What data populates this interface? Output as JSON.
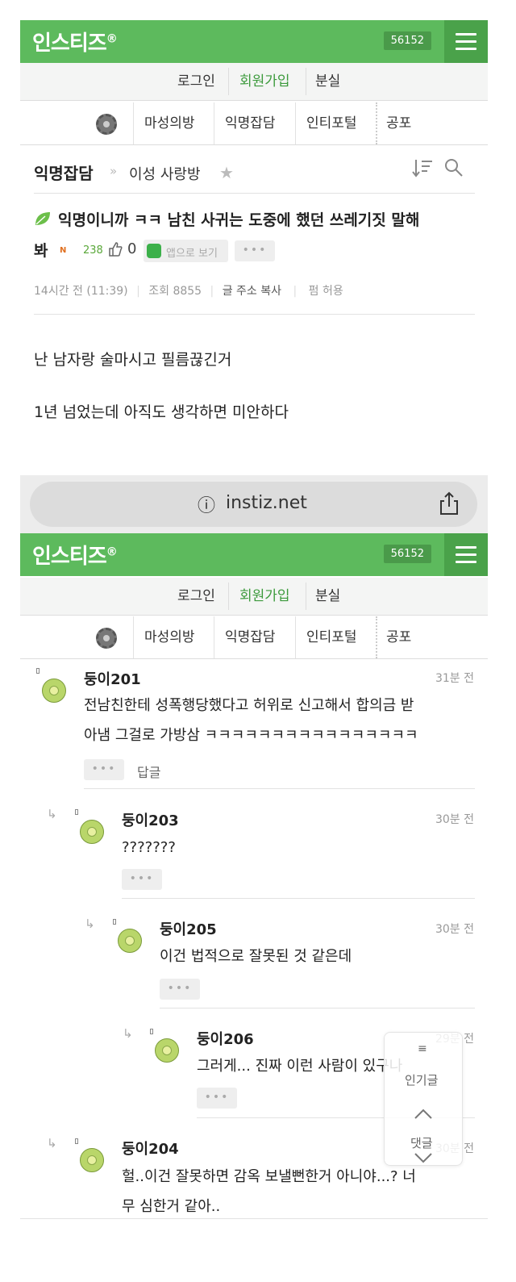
{
  "site": {
    "logo": "인스티즈",
    "logo_mark": "®",
    "user_count": "56152"
  },
  "nav_top": {
    "login": "로그인",
    "signup": "회원가입",
    "lost": "분실"
  },
  "nav_board": {
    "magic": "마성의방",
    "anon": "익명잡담",
    "portal": "인티포털",
    "horror": "공포"
  },
  "breadcrumb": {
    "board": "익명잡담",
    "sep": "»",
    "category": "이성 사랑방",
    "star": "★"
  },
  "post": {
    "title_line1": "익명이니까 ㅋㅋ 남친 사귀는 도중에 했던 쓰레기짓 말해",
    "title_line2": "봐",
    "new_badge": "N",
    "views_small": "238",
    "likes": "0",
    "app_view": "앱으로 보기",
    "more": "•••",
    "time": "14시간 전 (11:39)",
    "views": "조회 8855",
    "copy_addr": "글 주소 복사",
    "share": "펌 허용",
    "body_line1": "난 남자랑 술마시고 필름끊긴거",
    "body_line2": "1년 넘었는데 아직도 생각하면 미안하다"
  },
  "browser": {
    "url": "instiz.net",
    "info_icon": "ⓘ"
  },
  "comments": [
    {
      "name": "둥이201",
      "time": "31분 전",
      "line1": "전남친한테 성폭행당했다고 허위로 신고해서 합의금 받",
      "line2": "아냄 그걸로 가방삼 ㅋㅋㅋㅋㅋㅋㅋㅋㅋㅋㅋㅋㅋㅋㅋㅋ",
      "more": "•••",
      "reply": "답글"
    },
    {
      "name": "둥이203",
      "time": "30분 전",
      "line1": "???????",
      "more": "•••"
    },
    {
      "name": "둥이205",
      "time": "30분 전",
      "line1": "이건 법적으로 잘못된 것 같은데",
      "more": "•••"
    },
    {
      "name": "둥이206",
      "time": "29분 전",
      "line1": "그러게... 진짜 이런 사람이 있구나",
      "more": "•••"
    },
    {
      "name": "둥이204",
      "time": "30분 전",
      "line1": "헐..이건 잘못하면 감옥 보낼뻔한거 아니야...? 너",
      "line2": "무 심한거 같아.."
    }
  ],
  "float_panel": {
    "popular": "인기글",
    "comments": "댓글"
  }
}
